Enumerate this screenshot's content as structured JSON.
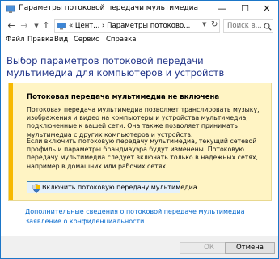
{
  "window": {
    "title": "Параметры потоковой передачи мультимедиа",
    "controls": {
      "minimize": "—",
      "maximize": "☐",
      "close": "✕"
    }
  },
  "address": {
    "path": "« Цент... › Параметры потоково...",
    "search_placeholder": "Поиск в..."
  },
  "menu": {
    "items": [
      "Файл",
      "Правка",
      "Вид",
      "Сервис",
      "Справка"
    ]
  },
  "main": {
    "heading": "Выбор параметров потоковой передачи мультимедиа для компьютеров и устройств",
    "info": {
      "title": "Потоковая передача мультимедиа не включена",
      "paragraph1": "Потоковая передача мультимедиа позволяет транслировать музыку, изображения и видео на компьютеры и устройства мультимедиа, подключенные к вашей сети. Она также позволяет принимать мультимедиа с других компьютеров и устройств.",
      "paragraph2": "Если включить потоковую передачу мультимедиа, текущий сетевой профиль и параметры брандмауэра будут изменены. Потоковую передачу мультимедиа следует включать только в надежных сетях, например в домашних или рабочих сетях.",
      "button": "Включить потоковую передачу мультимедиа"
    },
    "links": [
      "Дополнительные сведения о потоковой передаче мультимедиа",
      "Заявление о конфиденциальности"
    ]
  },
  "footer": {
    "ok": "ОК",
    "cancel": "Отмена"
  },
  "colors": {
    "heading": "#1e3287",
    "link": "#0066cc",
    "info_background": "#fff4c4",
    "info_accent": "#f7b900"
  }
}
